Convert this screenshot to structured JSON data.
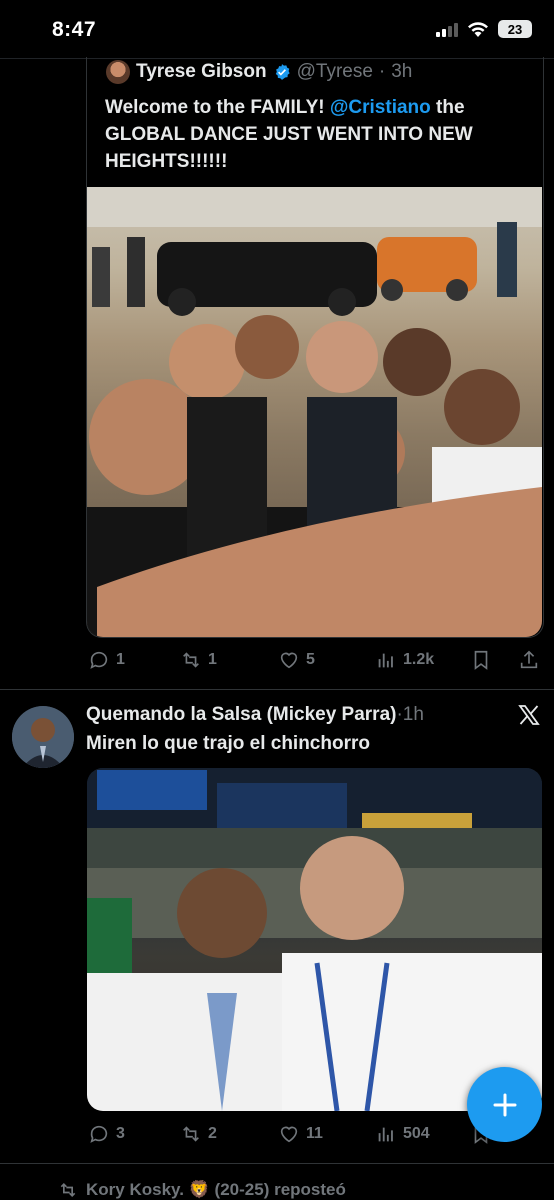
{
  "status_bar": {
    "time": "8:47",
    "battery": "23"
  },
  "quoted_tweet": {
    "author_name": "Tyrese Gibson",
    "handle": "@Tyrese",
    "separator": "·",
    "time": "3h",
    "text_part1": "Welcome to the FAMILY! ",
    "mention": "@Cristiano",
    "text_part2": " the GLOBAL DANCE JUST WENT INTO NEW HEIGHTS!!!!!!",
    "actions": {
      "replies": "1",
      "reposts": "1",
      "likes": "5",
      "views": "1.2k"
    }
  },
  "tweet2": {
    "author_name": "Quemando la Salsa (Mickey Parra)",
    "separator": "·",
    "time": "1h",
    "text": "Miren lo que trajo el chinchorro",
    "actions": {
      "replies": "3",
      "reposts": "2",
      "likes": "11",
      "views": "504"
    }
  },
  "repost_bar": {
    "text": "Kory Kosky. 🦁 (20-25) reposteó"
  },
  "colors": {
    "accent": "#1d9bf0",
    "background": "#000000",
    "muted": "#71767b"
  }
}
